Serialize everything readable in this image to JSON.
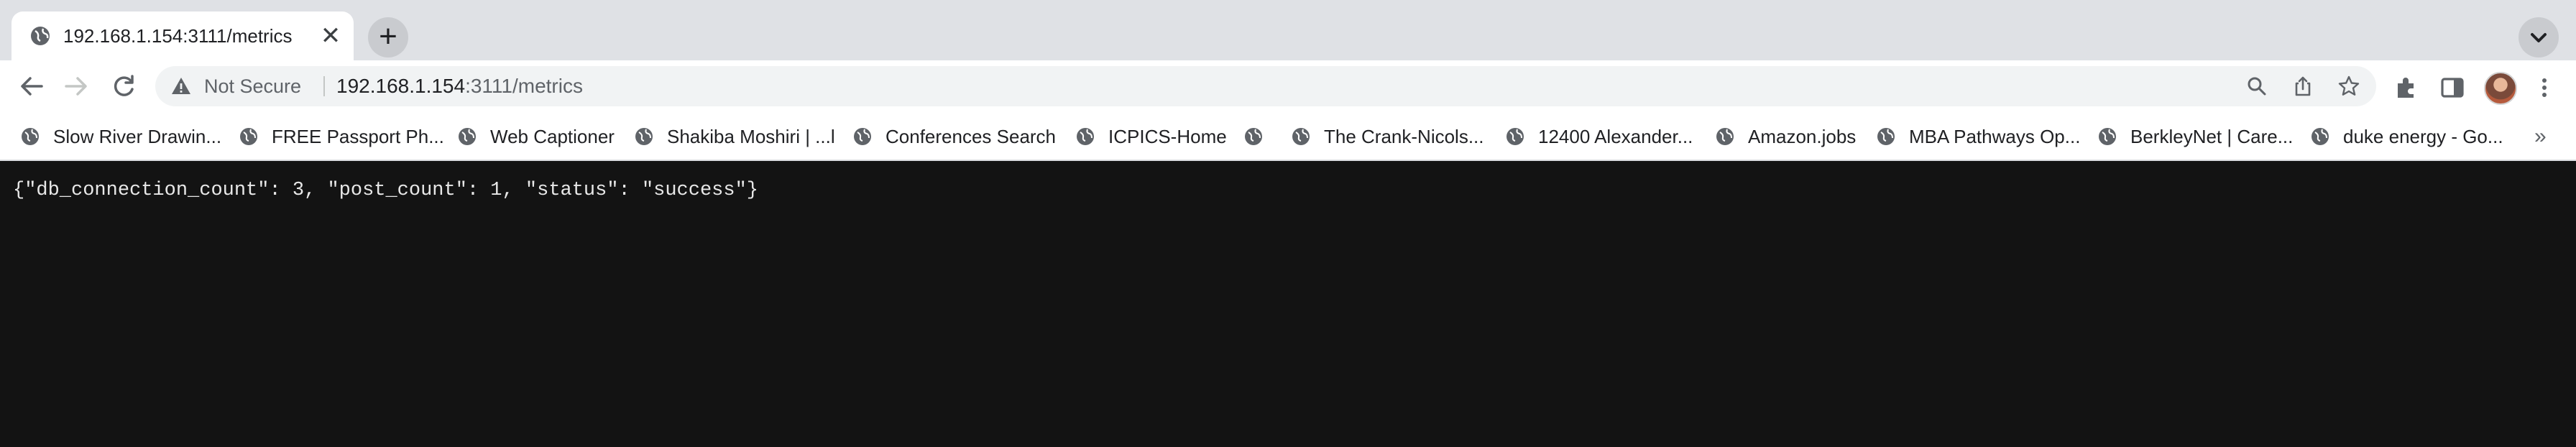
{
  "browser": {
    "tab": {
      "title": "192.168.1.154:3111/metrics",
      "close_glyph": "✕",
      "favicon": "globe-icon"
    },
    "new_tab_glyph": "+",
    "address_bar": {
      "security_label": "Not Secure",
      "url_host": "192.168.1.154",
      "url_path": ":3111/metrics"
    },
    "bookmarks": [
      {
        "label": "Slow River Drawin..."
      },
      {
        "label": "FREE Passport Ph..."
      },
      {
        "label": "Web Captioner"
      },
      {
        "label": "Shakiba Moshiri | ...l"
      },
      {
        "label": "Conferences Search"
      },
      {
        "label": "ICPICS-Home"
      },
      {
        "label": ""
      },
      {
        "label": "The Crank-Nicols..."
      },
      {
        "label": "12400 Alexander..."
      },
      {
        "label": "Amazon.jobs"
      },
      {
        "label": "MBA Pathways Op..."
      },
      {
        "label": "BerkleyNet | Care..."
      },
      {
        "label": "duke energy - Go..."
      }
    ],
    "bookmarks_overflow_glyph": "»"
  },
  "page": {
    "body_text": "{\"db_connection_count\": 3, \"post_count\": 1, \"status\": \"success\"}"
  },
  "colors": {
    "page_background": "#131313",
    "page_text": "#e8e8e8",
    "tabstrip": "#dfe1e5",
    "omnibox": "#f1f3f4"
  }
}
